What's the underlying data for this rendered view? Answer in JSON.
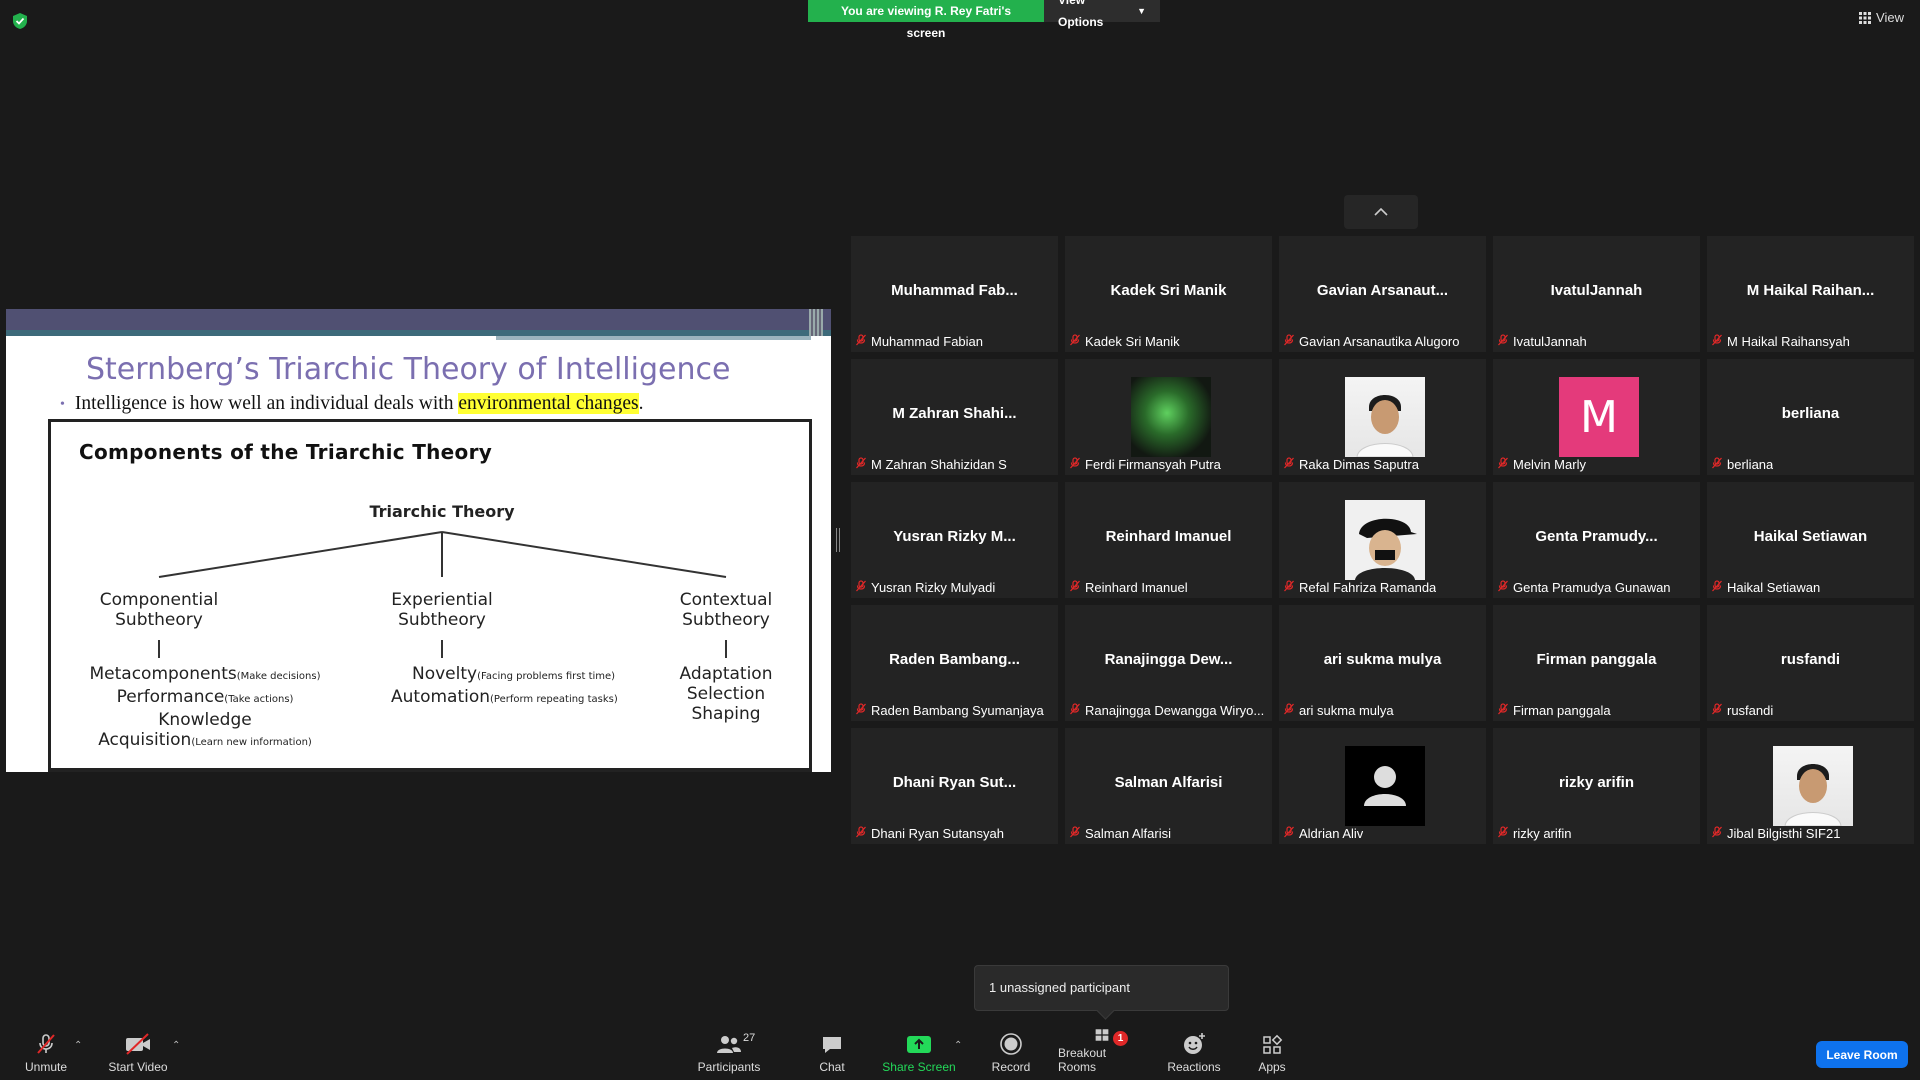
{
  "banner": {
    "text": "You are viewing R. Rey Fatri's screen",
    "view_options": "View Options"
  },
  "top_right": {
    "view": "View"
  },
  "slide": {
    "title": "Sternberg’s Triarchic Theory of Intelligence",
    "bullet_pre": "Intelligence is how well an individual deals with ",
    "bullet_highlight": "environmental changes",
    "bullet_post": ".",
    "figure_title": "Components of the Triarchic Theory",
    "root": "Triarchic Theory",
    "subs": [
      {
        "line1": "Componential",
        "line2": "Subtheory"
      },
      {
        "line1": "Experiential",
        "line2": "Subtheory"
      },
      {
        "line1": "Contextual",
        "line2": "Subtheory"
      }
    ],
    "componential": [
      {
        "text": "Metacomponents",
        "note": "(Make decisions)"
      },
      {
        "text": "Performance",
        "note": "(Take actions)"
      },
      {
        "text": "Knowledge",
        "note": ""
      },
      {
        "text": "Acquisition",
        "note": "(Learn new information)"
      }
    ],
    "experiential": [
      {
        "text": "Novelty",
        "note": "(Facing problems first time)"
      },
      {
        "text": "Automation",
        "note": "(Perform repeating tasks)"
      }
    ],
    "contextual": [
      "Adaptation",
      "Selection",
      "Shaping"
    ]
  },
  "participants": [
    {
      "display": "Muhammad  Fab...",
      "name": "Muhammad Fabian",
      "avatar": "none"
    },
    {
      "display": "Kadek Sri Manik",
      "name": "Kadek Sri Manik",
      "avatar": "none"
    },
    {
      "display": "Gavian  Arsanaut...",
      "name": "Gavian Arsanautika Alugoro",
      "avatar": "none"
    },
    {
      "display": "IvatulJannah",
      "name": "IvatulJannah",
      "avatar": "none"
    },
    {
      "display": "M  Haikal  Raihan...",
      "name": "M Haikal Raihansyah",
      "avatar": "none"
    },
    {
      "display": "M  Zahran  Shahi...",
      "name": "M Zahran Shahizidan S",
      "avatar": "none"
    },
    {
      "display": "",
      "name": "Ferdi Firmansyah Putra",
      "avatar": "photo-green"
    },
    {
      "display": "",
      "name": "Raka Dimas Saputra",
      "avatar": "photo-person"
    },
    {
      "display": "",
      "name": "Melvin Marly",
      "avatar": "initial",
      "initial": "M"
    },
    {
      "display": "berliana",
      "name": "berliana",
      "avatar": "none"
    },
    {
      "display": "Yusran  Rizky  M...",
      "name": "Yusran Rizky Mulyadi",
      "avatar": "none"
    },
    {
      "display": "Reinhard Imanuel",
      "name": "Reinhard Imanuel",
      "avatar": "none"
    },
    {
      "display": "",
      "name": "Refal Fahriza Ramanda",
      "avatar": "photo-cap"
    },
    {
      "display": "Genta  Pramudy...",
      "name": "Genta Pramudya Gunawan",
      "avatar": "none"
    },
    {
      "display": "Haikal Setiawan",
      "name": "Haikal Setiawan",
      "avatar": "none"
    },
    {
      "display": "Raden  Bambang...",
      "name": "Raden Bambang Syumanjaya",
      "avatar": "none"
    },
    {
      "display": "Ranajingga  Dew...",
      "name": "Ranajingga Dewangga Wiryo...",
      "avatar": "none"
    },
    {
      "display": "ari sukma mulya",
      "name": "ari sukma mulya",
      "avatar": "none"
    },
    {
      "display": "Firman panggala",
      "name": "Firman panggala",
      "avatar": "none"
    },
    {
      "display": "rusfandi",
      "name": "rusfandi",
      "avatar": "none"
    },
    {
      "display": "Dhani  Ryan  Sut...",
      "name": "Dhani Ryan Sutansyah",
      "avatar": "none"
    },
    {
      "display": "Salman Alfarisi",
      "name": "Salman Alfarisi",
      "avatar": "none"
    },
    {
      "display": "",
      "name": "Aldrian Aliv",
      "avatar": "default"
    },
    {
      "display": "rizky arifin",
      "name": "rizky arifin",
      "avatar": "none"
    },
    {
      "display": "",
      "name": "Jibal Bilgisthi SIF21",
      "avatar": "photo-person"
    }
  ],
  "tooltip": "1 unassigned participant",
  "toolbar": {
    "unmute": "Unmute",
    "start_video": "Start Video",
    "participants": "Participants",
    "participants_count": "27",
    "chat": "Chat",
    "share_screen": "Share Screen",
    "record": "Record",
    "breakout_rooms": "Breakout Rooms",
    "breakout_badge": "1",
    "reactions": "Reactions",
    "apps": "Apps",
    "leave": "Leave Room"
  },
  "colors": {
    "banner_green": "#23b14d",
    "share_green": "#23d959",
    "leave_blue": "#0e72ed",
    "mic_off_red": "#e02828"
  }
}
